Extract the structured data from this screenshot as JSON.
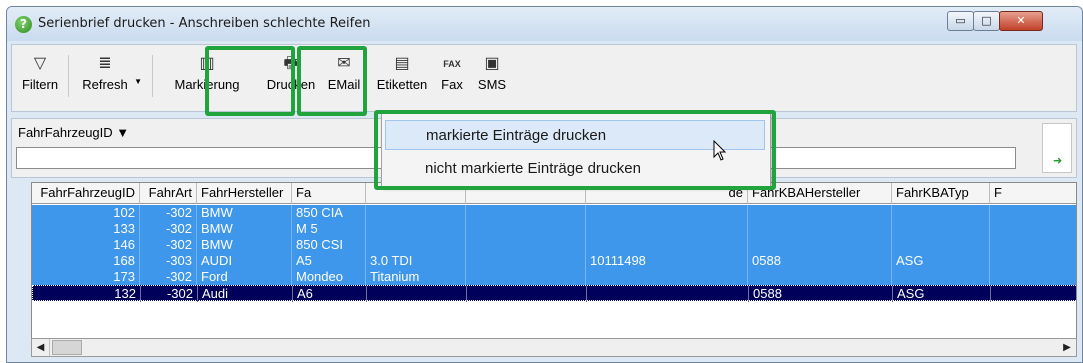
{
  "window": {
    "title": "Serienbrief drucken - Anschreiben schlechte Reifen",
    "help_icon": "question-icon",
    "controls": {
      "minimize": "▭",
      "maximize": "□",
      "close": "✕"
    }
  },
  "toolbar": {
    "buttons": [
      {
        "id": "filter",
        "label": "Filtern",
        "icon": "funnel-icon",
        "glyph": "▽"
      },
      {
        "id": "refresh",
        "label": "Refresh",
        "icon": "refresh-icon",
        "glyph": "≣"
      },
      {
        "id": "markierung",
        "label": "Markierung",
        "icon": "columns-icon",
        "glyph": "▥"
      },
      {
        "id": "drucken",
        "label": "Drucken",
        "icon": "printer-icon",
        "glyph": "🖶"
      },
      {
        "id": "email",
        "label": "EMail",
        "icon": "email-icon",
        "glyph": "✉"
      },
      {
        "id": "etiketten",
        "label": "Etiketten",
        "icon": "label-icon",
        "glyph": "▤"
      },
      {
        "id": "fax",
        "label": "Fax",
        "icon": "fax-icon",
        "glyph": "FAX"
      },
      {
        "id": "sms",
        "label": "SMS",
        "icon": "sms-icon",
        "glyph": "▣"
      }
    ]
  },
  "filter": {
    "field_label": "FahrFahrzeugID ▼",
    "value": ""
  },
  "popup_menu": {
    "items": [
      {
        "label": "markierte Einträge drucken",
        "highlighted": true
      },
      {
        "label": "nicht markierte Einträge drucken",
        "highlighted": false
      }
    ]
  },
  "grid": {
    "columns": [
      "FahrFahrzeugID",
      "FahrArt",
      "FahrHersteller",
      "Fa",
      "",
      "",
      "de",
      "FahrKBAHersteller",
      "FahrKBATyp",
      "F"
    ],
    "rows": [
      [
        "102",
        "-302",
        "BMW",
        "850 CIA",
        "",
        "",
        "",
        "",
        ""
      ],
      [
        "133",
        "-302",
        "BMW",
        "M 5",
        "",
        "",
        "",
        "",
        ""
      ],
      [
        "146",
        "-302",
        "BMW",
        "850 CSI",
        "",
        "",
        "",
        "",
        ""
      ],
      [
        "168",
        "-303",
        "AUDI",
        "A5",
        "3.0 TDI",
        "",
        "10111498",
        "0588",
        "ASG"
      ],
      [
        "173",
        "-302",
        "Ford",
        "Mondeo",
        "Titanium",
        "",
        "",
        "",
        ""
      ],
      [
        "132",
        "-302",
        "Audi",
        "A6",
        "",
        "",
        "",
        "0588",
        "ASG"
      ]
    ]
  },
  "colors": {
    "row_selection": "#3e97ea",
    "current_row": "#00005a",
    "highlight_box": "#21a33d"
  }
}
